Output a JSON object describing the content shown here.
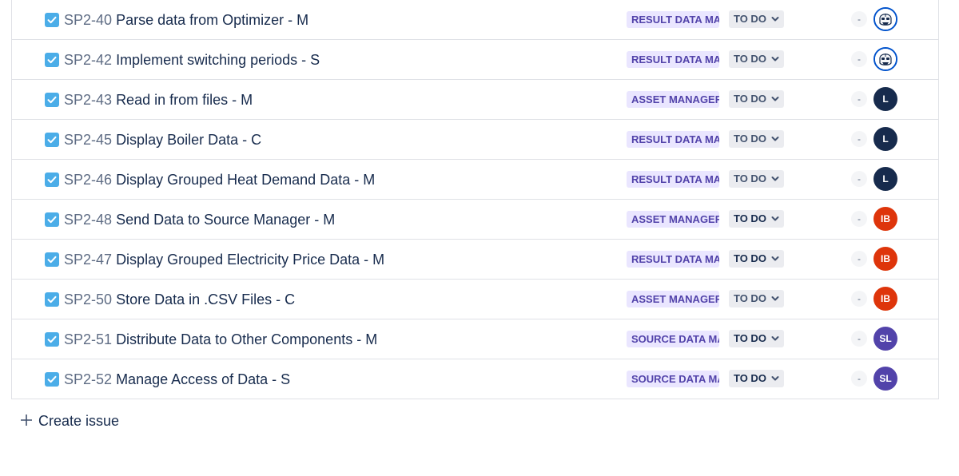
{
  "issues": [
    {
      "key": "SP2-40",
      "title": "Parse data from Optimizer - M",
      "epic": "RESULT DATA MANAGER",
      "status": "TO DO",
      "estimate": "-",
      "assignee": {
        "type": "trooper",
        "initials": "",
        "color": "#0052cc"
      }
    },
    {
      "key": "SP2-42",
      "title": "Implement switching periods - S",
      "epic": "RESULT DATA MANAGER",
      "status": "TO DO",
      "estimate": "-",
      "assignee": {
        "type": "trooper",
        "initials": "",
        "color": "#0052cc"
      }
    },
    {
      "key": "SP2-43",
      "title": "Read in from files - M",
      "epic": "ASSET MANAGER",
      "status": "TO DO",
      "estimate": "-",
      "assignee": {
        "type": "initials",
        "initials": "L",
        "color": "#172b4d"
      }
    },
    {
      "key": "SP2-45",
      "title": "Display Boiler Data - C",
      "epic": "RESULT DATA MANAGER",
      "status": "TO DO",
      "estimate": "-",
      "assignee": {
        "type": "initials",
        "initials": "L",
        "color": "#172b4d"
      }
    },
    {
      "key": "SP2-46",
      "title": "Display Grouped Heat Demand Data - M",
      "epic": "RESULT DATA MANAGER",
      "status": "TO DO",
      "estimate": "-",
      "assignee": {
        "type": "initials",
        "initials": "L",
        "color": "#172b4d"
      }
    },
    {
      "key": "SP2-48",
      "title": "Send Data to Source Manager - M",
      "epic": "ASSET MANAGER",
      "status": "TO DO",
      "estimate": "-",
      "assignee": {
        "type": "initials",
        "initials": "IB",
        "color": "#de350b"
      }
    },
    {
      "key": "SP2-47",
      "title": "Display Grouped Electricity Price Data - M",
      "epic": "RESULT DATA MANAGER",
      "status": "TO DO",
      "estimate": "-",
      "assignee": {
        "type": "initials",
        "initials": "IB",
        "color": "#de350b"
      }
    },
    {
      "key": "SP2-50",
      "title": "Store Data in .CSV Files - C",
      "epic": "ASSET MANAGER",
      "status": "TO DO",
      "estimate": "-",
      "assignee": {
        "type": "initials",
        "initials": "IB",
        "color": "#de350b"
      }
    },
    {
      "key": "SP2-51",
      "title": "Distribute Data to Other Components - M",
      "epic": "SOURCE DATA MANAGER",
      "status": "TO DO",
      "estimate": "-",
      "assignee": {
        "type": "initials",
        "initials": "SL",
        "color": "#5243aa"
      }
    },
    {
      "key": "SP2-52",
      "title": "Manage Access of Data - S",
      "epic": "SOURCE DATA MANAGER",
      "status": "TO DO",
      "estimate": "-",
      "assignee": {
        "type": "initials",
        "initials": "SL",
        "color": "#5243aa"
      }
    }
  ],
  "create_issue_label": "Create issue",
  "colors": {
    "checkbox": "#4bade8",
    "epic_bg": "#eae6ff",
    "epic_text": "#5243aa",
    "status_bg": "#ebecf0"
  },
  "icons": {
    "checkbox": "task-checkbox-icon",
    "chevron": "chevron-down-icon",
    "plus": "plus-icon"
  }
}
